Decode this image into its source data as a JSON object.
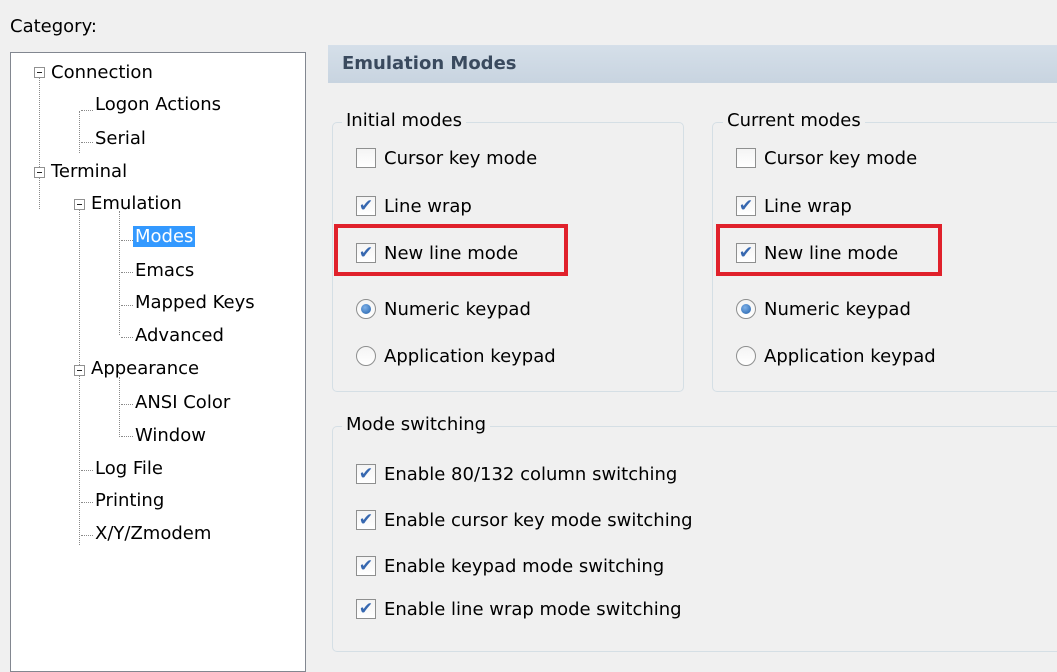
{
  "category_label": "Category:",
  "tree": {
    "items": [
      {
        "label": "Connection"
      },
      {
        "label": "Logon Actions"
      },
      {
        "label": "Serial"
      },
      {
        "label": "Terminal"
      },
      {
        "label": "Emulation"
      },
      {
        "label": "Modes"
      },
      {
        "label": "Emacs"
      },
      {
        "label": "Mapped Keys"
      },
      {
        "label": "Advanced"
      },
      {
        "label": "Appearance"
      },
      {
        "label": "ANSI Color"
      },
      {
        "label": "Window"
      },
      {
        "label": "Log File"
      },
      {
        "label": "Printing"
      },
      {
        "label": "X/Y/Zmodem"
      }
    ],
    "selected": "Modes"
  },
  "header": {
    "title": "Emulation Modes"
  },
  "initial_modes": {
    "title": "Initial modes",
    "cursor_key_mode": {
      "label": "Cursor key mode",
      "checked": false
    },
    "line_wrap": {
      "label": "Line wrap",
      "checked": true
    },
    "new_line_mode": {
      "label": "New line mode",
      "checked": true
    },
    "numeric_keypad": {
      "label": "Numeric keypad",
      "selected": true
    },
    "application_keypad": {
      "label": "Application keypad",
      "selected": false
    }
  },
  "current_modes": {
    "title": "Current modes",
    "cursor_key_mode": {
      "label": "Cursor key mode",
      "checked": false
    },
    "line_wrap": {
      "label": "Line wrap",
      "checked": true
    },
    "new_line_mode": {
      "label": "New line mode",
      "checked": true
    },
    "numeric_keypad": {
      "label": "Numeric keypad",
      "selected": true
    },
    "application_keypad": {
      "label": "Application keypad",
      "selected": false
    }
  },
  "mode_switching": {
    "title": "Mode switching",
    "items": [
      {
        "label": "Enable 80/132 column switching",
        "checked": true
      },
      {
        "label": "Enable cursor key mode switching",
        "checked": true
      },
      {
        "label": "Enable keypad mode switching",
        "checked": true
      },
      {
        "label": "Enable line wrap mode switching",
        "checked": true
      }
    ]
  },
  "colors": {
    "highlight": "#e0212b",
    "selection": "#3399ff",
    "header_bg": "#d0dbe6"
  }
}
